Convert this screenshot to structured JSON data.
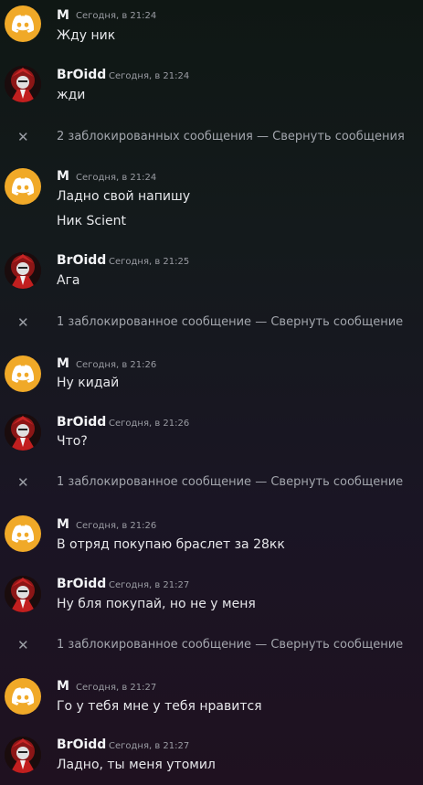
{
  "users": {
    "m": "M",
    "b": "BrOidd"
  },
  "messages": [
    {
      "user": "M",
      "time": "Сегодня, в 21:24",
      "lines": [
        "Жду ник"
      ]
    },
    {
      "user": "BrOidd",
      "time": "Сегодня, в 21:24",
      "lines": [
        "жди"
      ]
    },
    {
      "blocked": "2 заблокированных сообщения",
      "dash": "—",
      "link": "Свернуть сообщения"
    },
    {
      "user": "M",
      "time": "Сегодня, в 21:24",
      "lines": [
        "Ладно свой напишу",
        "Ник Scient"
      ]
    },
    {
      "user": "BrOidd",
      "time": "Сегодня, в 21:25",
      "lines": [
        "Ага"
      ]
    },
    {
      "blocked": "1 заблокированное сообщение",
      "dash": "—",
      "link": "Свернуть сообщение"
    },
    {
      "user": "M",
      "time": "Сегодня, в 21:26",
      "lines": [
        "Ну кидай"
      ]
    },
    {
      "user": "BrOidd",
      "time": "Сегодня, в 21:26",
      "lines": [
        "Что?"
      ]
    },
    {
      "blocked": "1 заблокированное сообщение",
      "dash": "—",
      "link": "Свернуть сообщение"
    },
    {
      "user": "M",
      "time": "Сегодня, в 21:26",
      "lines": [
        "В отряд покупаю браслет за 28кк"
      ]
    },
    {
      "user": "BrOidd",
      "time": "Сегодня, в 21:27",
      "lines": [
        "Ну бля покупай, но не у меня"
      ]
    },
    {
      "blocked": "1 заблокированное сообщение",
      "dash": "—",
      "link": "Свернуть сообщение"
    },
    {
      "user": "M",
      "time": "Сегодня, в 21:27",
      "lines": [
        "Го у тебя мне у тебя нравится"
      ]
    },
    {
      "user": "BrOidd",
      "time": "Сегодня, в 21:27",
      "lines": [
        "Ладно, ты меня утомил"
      ]
    }
  ],
  "icons": {
    "close": "close-icon",
    "discord": "discord-logo-icon"
  },
  "colors": {
    "discord_avatar": "#f0a928",
    "link": "#a3a6ad",
    "name": "#f2f3f5"
  }
}
